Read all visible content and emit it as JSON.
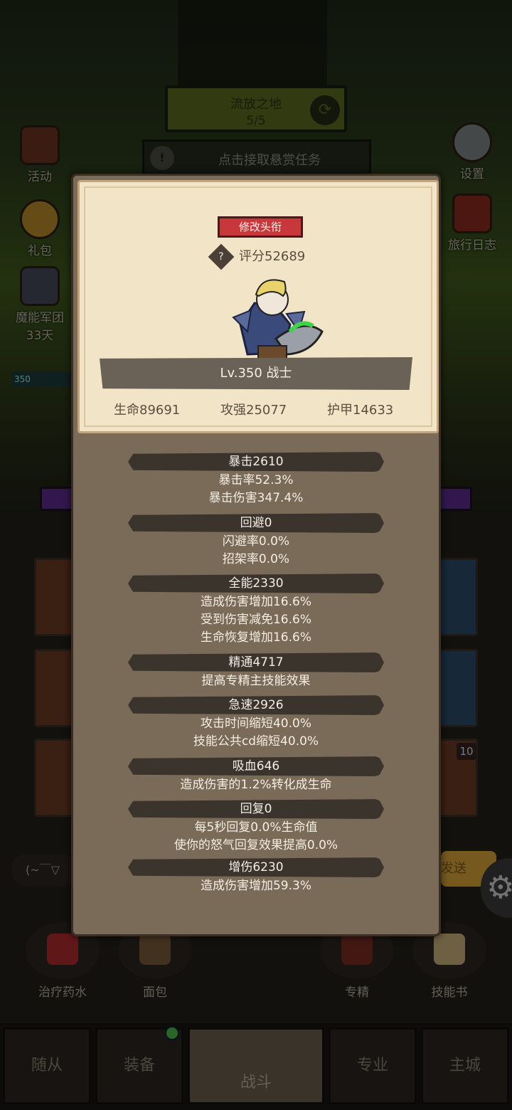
{
  "background": {
    "stage": {
      "name": "流放之地",
      "progress": "5/5",
      "refresh_icon": "refresh-icon"
    },
    "bounty": {
      "icon": "alert-icon",
      "text": "点击接取悬赏任务"
    },
    "left_buttons": [
      {
        "label": "活动",
        "icon": "activity-icon"
      },
      {
        "label": "礼包",
        "icon": "gift-icon"
      },
      {
        "label": "魔能军团",
        "sub": "33天",
        "icon": "legion-icon"
      }
    ],
    "right_buttons": [
      {
        "label": "设置",
        "icon": "gear-icon"
      },
      {
        "label": "旅行日志",
        "icon": "journal-icon"
      }
    ],
    "level_chip": "350",
    "chat_placeholder": "(~￣▽",
    "send_label": "发送",
    "slot_badge": "10",
    "items": [
      {
        "label": "治疗药水",
        "icon": "potion-icon"
      },
      {
        "label": "面包",
        "icon": "bread-icon"
      },
      {
        "label": "专精",
        "icon": "specialization-icon"
      },
      {
        "label": "技能书",
        "icon": "skillbook-icon"
      }
    ],
    "nav": [
      {
        "label": "随从",
        "active": false
      },
      {
        "label": "装备",
        "active": false
      },
      {
        "label": "战斗",
        "active": true
      },
      {
        "label": "专业",
        "active": false
      },
      {
        "label": "主城",
        "active": false
      }
    ]
  },
  "panel": {
    "rename_label": "修改头衔",
    "score": "评分52689",
    "level_class": "Lv.350 战士",
    "base_stats": {
      "hp": "生命89691",
      "attack": "攻强25077",
      "armor": "护甲14633"
    },
    "groups": [
      {
        "title": "暴击2610",
        "lines": [
          "暴击率52.3%",
          "暴击伤害347.4%"
        ]
      },
      {
        "title": "回避0",
        "lines": [
          "闪避率0.0%",
          "招架率0.0%"
        ]
      },
      {
        "title": "全能2330",
        "lines": [
          "造成伤害增加16.6%",
          "受到伤害减免16.6%",
          "生命恢复增加16.6%"
        ]
      },
      {
        "title": "精通4717",
        "lines": [
          "提高专精主技能效果"
        ]
      },
      {
        "title": "急速2926",
        "lines": [
          "攻击时间缩短40.0%",
          "技能公共cd缩短40.0%"
        ]
      },
      {
        "title": "吸血646",
        "lines": [
          "造成伤害的1.2%转化成生命"
        ]
      },
      {
        "title": "回复0",
        "lines": [
          "每5秒回复0.0%生命值",
          "使你的怒气回复效果提高0.0%"
        ]
      },
      {
        "title": "增伤6230",
        "lines": [
          "造成伤害增加59.3%"
        ]
      }
    ]
  },
  "colors": {
    "accent_red": "#c8373a",
    "panel_bg": "#7a6a58",
    "parchment": "#f2e4c6",
    "pill": "#3b342d"
  }
}
